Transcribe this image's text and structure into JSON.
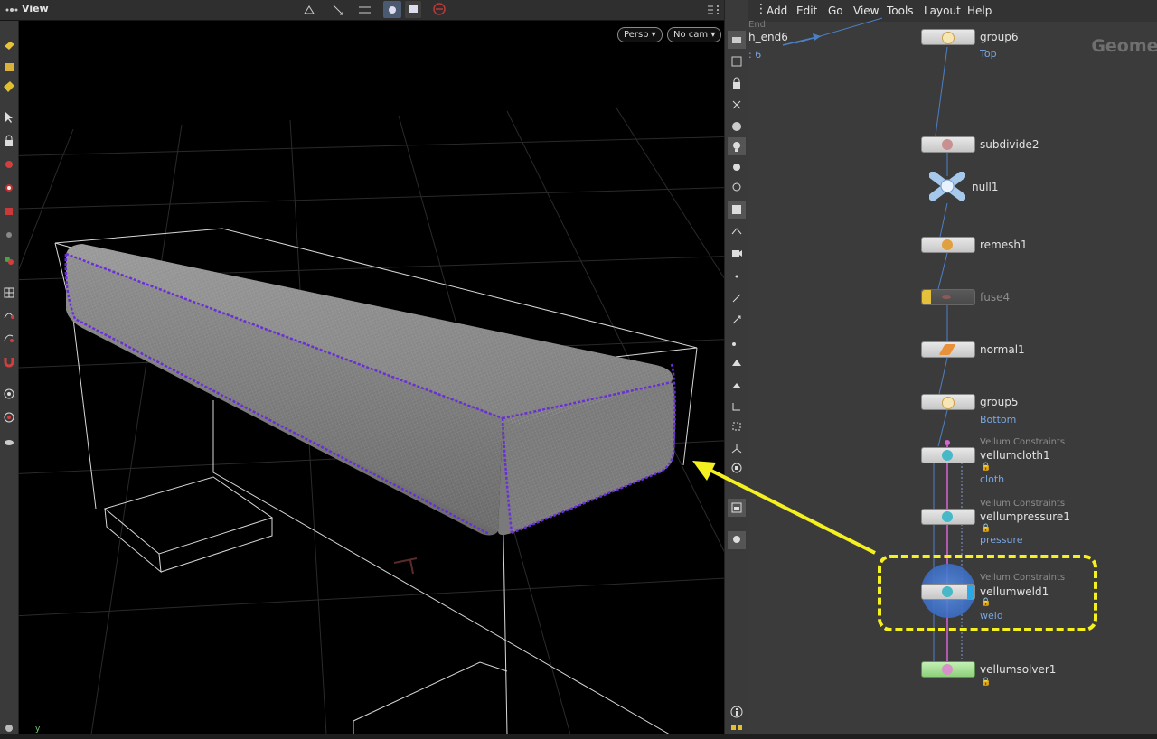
{
  "viewport": {
    "title": "View",
    "persp_label": "Persp ▾",
    "cam_label": "No cam ▾",
    "axis_label": "y"
  },
  "network": {
    "menu": [
      "Add",
      "Edit",
      "Go",
      "View",
      "Tools",
      "Layout",
      "Help"
    ],
    "context_label": "Geometr",
    "partial_node": {
      "line1": "End",
      "line2": "h_end6",
      "line3": ": 6"
    },
    "nodes": [
      {
        "name": "group6",
        "sub": "Top",
        "type": ""
      },
      {
        "name": "subdivide2",
        "sub": "",
        "type": ""
      },
      {
        "name": "null1",
        "sub": "",
        "type": ""
      },
      {
        "name": "remesh1",
        "sub": "",
        "type": ""
      },
      {
        "name": "fuse4",
        "sub": "",
        "type": ""
      },
      {
        "name": "normal1",
        "sub": "",
        "type": ""
      },
      {
        "name": "group5",
        "sub": "Bottom",
        "type": ""
      },
      {
        "name": "vellumcloth1",
        "sub": "cloth",
        "type": "Vellum Constraints"
      },
      {
        "name": "vellumpressure1",
        "sub": "pressure",
        "type": "Vellum Constraints"
      },
      {
        "name": "vellumweld1",
        "sub": "weld",
        "type": "Vellum Constraints"
      },
      {
        "name": "vellumsolver1",
        "sub": "",
        "type": ""
      }
    ]
  },
  "colors": {
    "annotation": "#f5f020",
    "selection_edge": "#6a2ed8",
    "subtitle": "#7aa8e4",
    "solver_node": "#a6e096",
    "selected_glow": "#3c6fd6"
  }
}
